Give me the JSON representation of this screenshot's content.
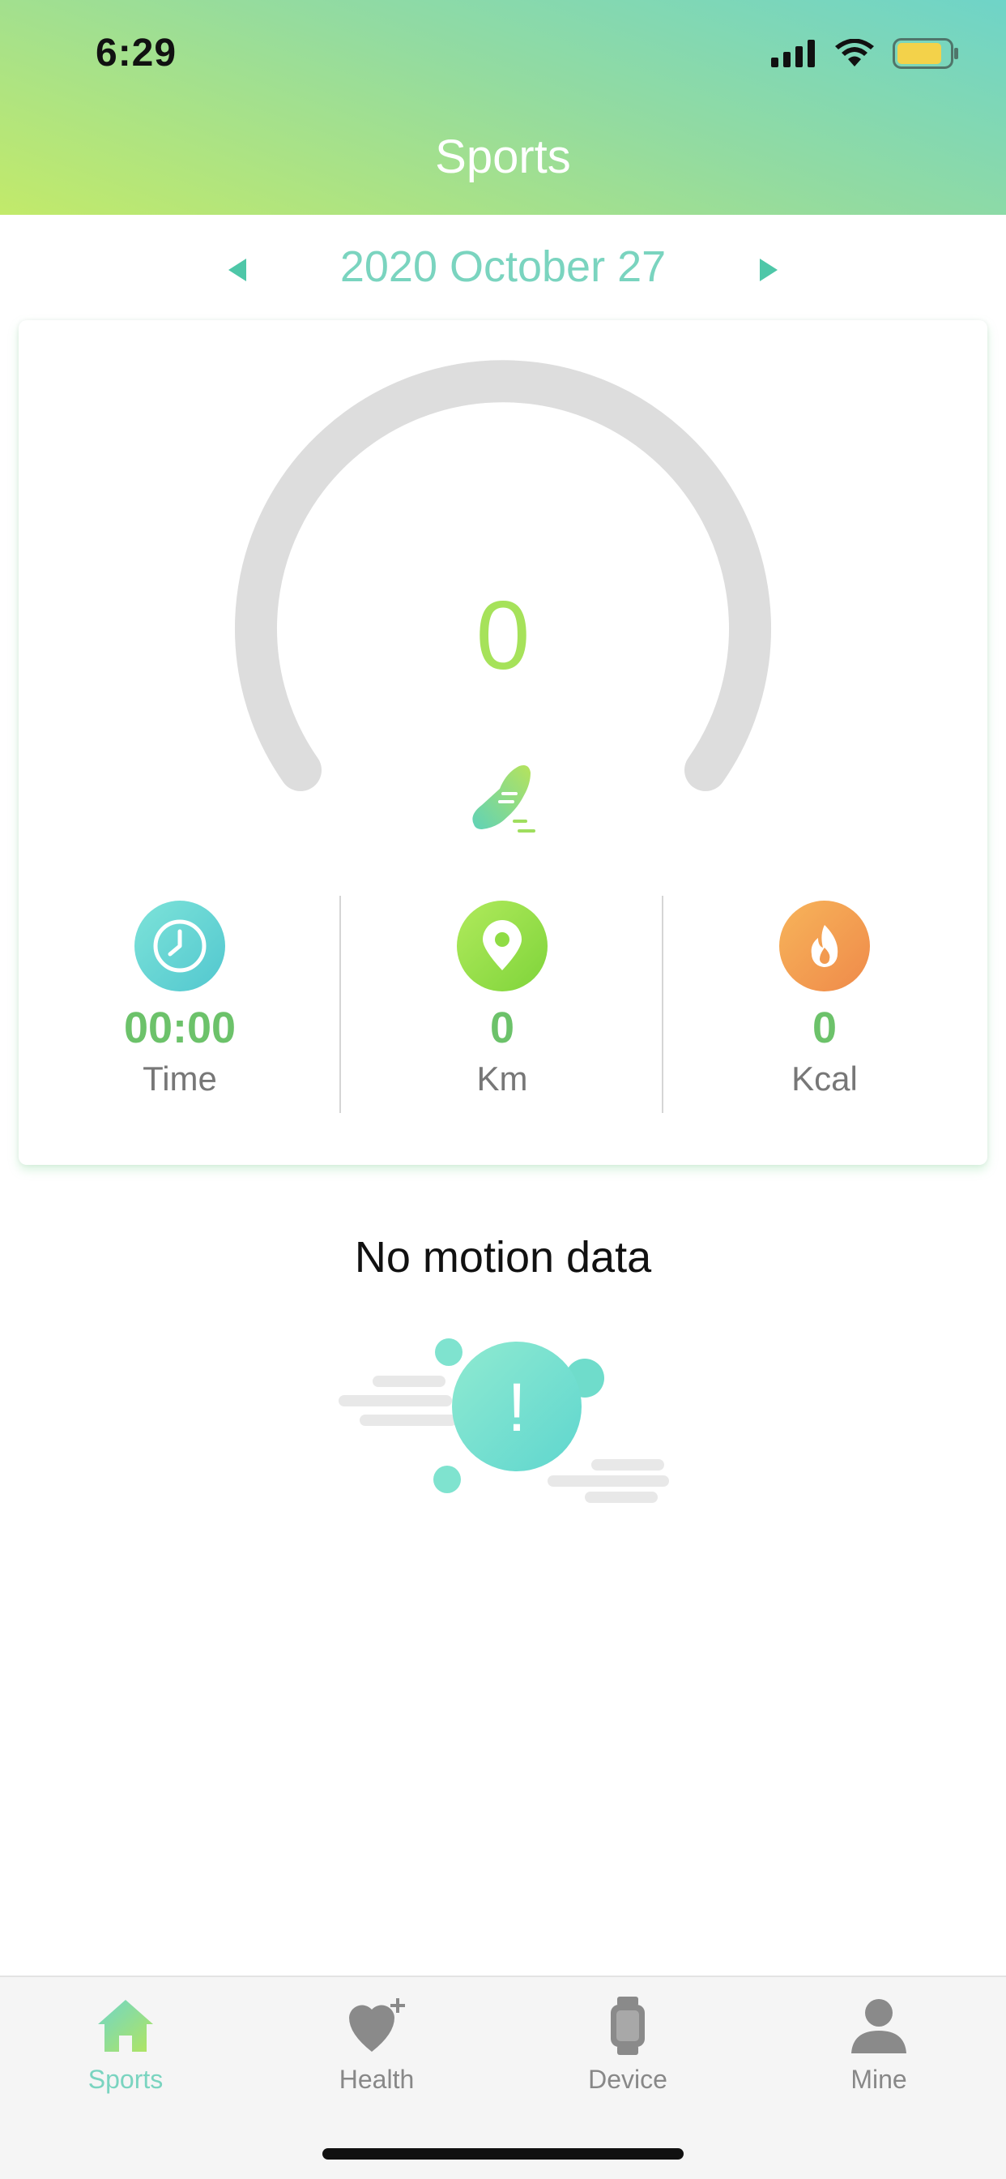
{
  "status_bar": {
    "time": "6:29"
  },
  "header": {
    "title": "Sports"
  },
  "date_selector": {
    "date": "2020 October 27"
  },
  "gauge": {
    "steps": "0"
  },
  "stats": [
    {
      "value": "00:00",
      "label": "Time",
      "icon": "clock-icon",
      "color": "#6fd4cf"
    },
    {
      "value": "0",
      "label": "Km",
      "icon": "location-pin-icon",
      "color": "#9be04a"
    },
    {
      "value": "0",
      "label": "Kcal",
      "icon": "flame-icon",
      "color": "#f39a50"
    }
  ],
  "empty_state": {
    "title": "No motion data",
    "badge": "!"
  },
  "tabs": [
    {
      "label": "Sports",
      "icon": "home-icon",
      "active": true
    },
    {
      "label": "Health",
      "icon": "heart-plus-icon",
      "active": false
    },
    {
      "label": "Device",
      "icon": "watch-icon",
      "active": false
    },
    {
      "label": "Mine",
      "icon": "person-icon",
      "active": false
    }
  ],
  "colors": {
    "accent": "#7ad4bf",
    "value_green": "#6cc26a",
    "gauge_track": "#dddddd",
    "battery": "#f3d24a"
  }
}
